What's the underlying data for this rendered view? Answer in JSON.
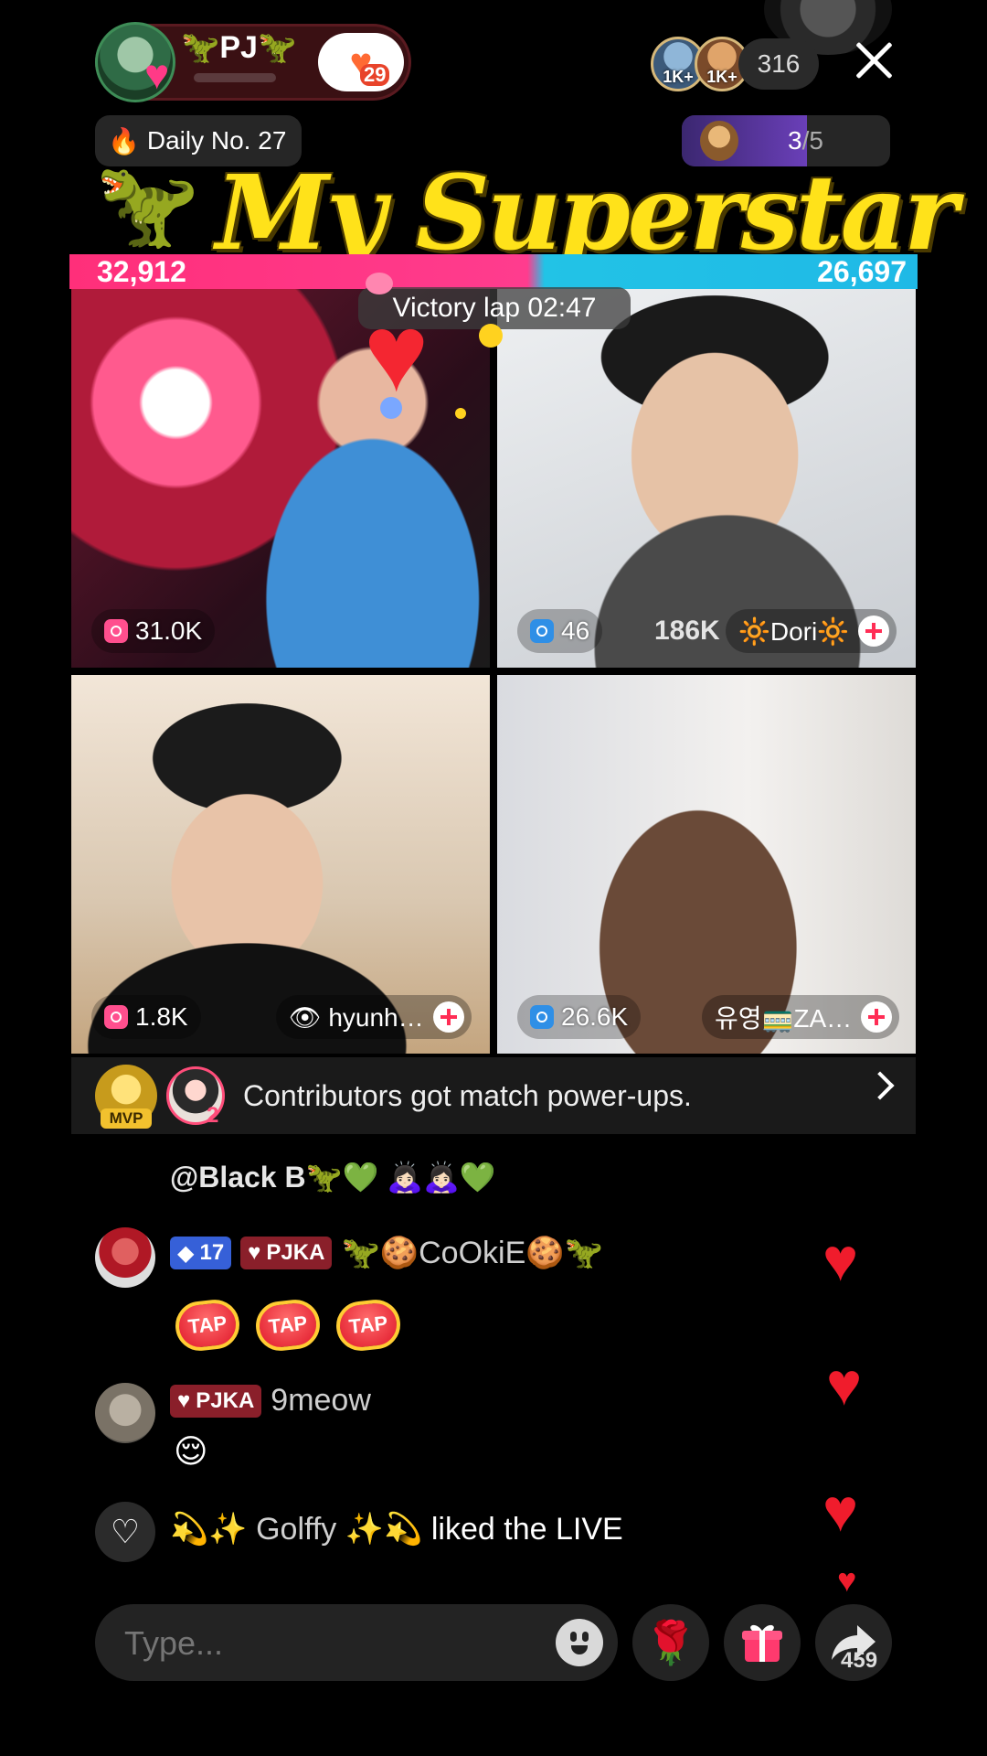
{
  "host": {
    "name": "PJ",
    "follow_count": "29"
  },
  "top_viewers": [
    {
      "label": "1K+"
    },
    {
      "label": "1K+"
    }
  ],
  "viewer_count": "316",
  "daily": {
    "label": "Daily No. 27"
  },
  "progress": {
    "current": "3",
    "total": "/5",
    "fraction": 0.6
  },
  "banner": {
    "title": "My Superstar"
  },
  "battle": {
    "left_score": "32,912",
    "right_score": "26,697",
    "victory_label": "Victory lap 02:47"
  },
  "tiles": [
    {
      "gifts": "31.0K",
      "gift_color": "pink"
    },
    {
      "gifts": "46",
      "gift_color": "blue",
      "overlay_number": "186K",
      "name": "🔆Dori🔆"
    },
    {
      "gifts": "1.8K",
      "gift_color": "pink",
      "name": "👁 hyunh…"
    },
    {
      "gifts": "26.6K",
      "gift_color": "blue",
      "name": "유영🚃ZA…"
    }
  ],
  "contributors": {
    "mvp_label": "MVP",
    "rank2": "2",
    "message": "Contributors got match power-ups."
  },
  "chat": [
    {
      "text": "@Black B🦖💚 🙇🏻‍♀️🙇🏻‍♀️💚"
    },
    {
      "level": "17",
      "fan_badge": "PJKA",
      "user": "🦖🍪CoOkiE🍪🦖",
      "sticker": "TAP"
    },
    {
      "fan_badge": "PJKA",
      "user": "9meow",
      "message": "😌"
    },
    {
      "user": "💫✨ Golffy ✨💫",
      "action": "liked the LIVE"
    }
  ],
  "composer": {
    "placeholder": "Type...",
    "share_count": "459"
  },
  "colors": {
    "score_left": "#ff2f7a",
    "score_right": "#22c3e6",
    "banner_title": "#ffe21a"
  }
}
